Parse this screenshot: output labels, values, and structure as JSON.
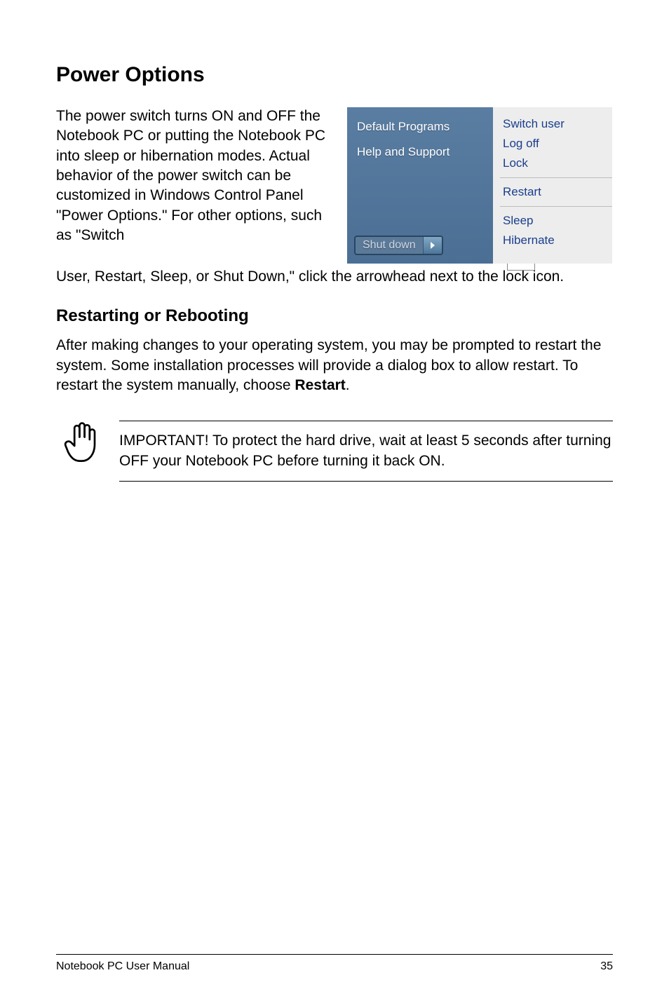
{
  "heading": "Power Options",
  "intro_left": "The power switch turns ON and OFF the Notebook PC or putting the Notebook PC into sleep or hibernation modes. Actual behavior of the power switch can be customized in Windows Control Panel \"Power Options.\" For other options, such as \"Switch",
  "intro_continuation": "User, Restart, Sleep, or Shut Down,\" click the arrowhead next to the lock icon.",
  "screenshot": {
    "left_panel": {
      "item1": "Default Programs",
      "item2": "Help and Support",
      "shutdown_label": "Shut down"
    },
    "right_menu": {
      "item1": "Switch user",
      "item2": "Log off",
      "item3": "Lock",
      "item4": "Restart",
      "item5": "Sleep",
      "item6": "Hibernate"
    }
  },
  "sub_heading": "Restarting or Rebooting",
  "sub_para_pre": "After making changes to your operating system, you may be prompted to restart the system. Some installation processes will provide a dialog box to allow restart. To restart the system manually, choose ",
  "sub_para_bold": "Restart",
  "sub_para_post": ".",
  "callout_text": "IMPORTANT!  To protect the hard drive, wait at least 5 seconds after turning OFF your Notebook PC before turning it back ON.",
  "footer_left": "Notebook PC User Manual",
  "footer_right": "35"
}
